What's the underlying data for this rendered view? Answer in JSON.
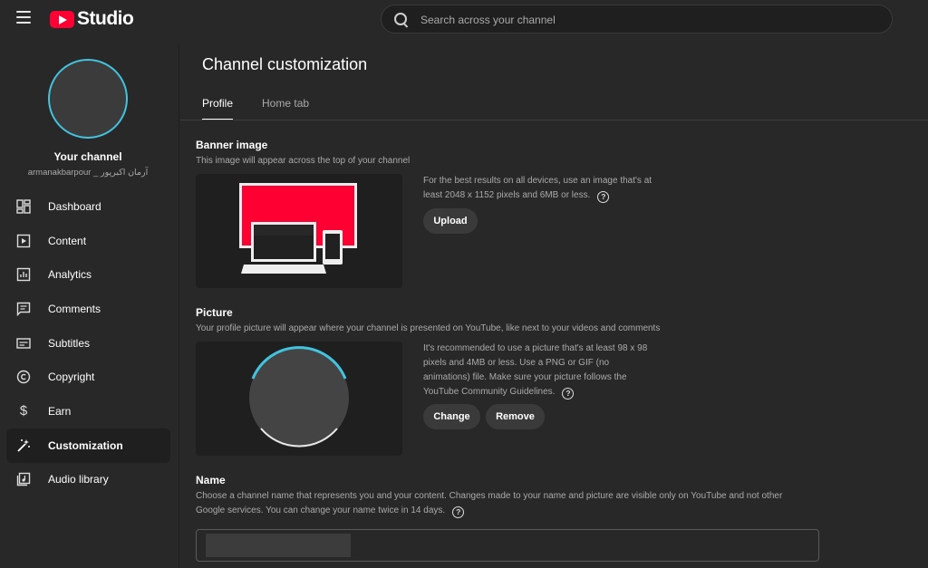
{
  "app": {
    "logo_text": "Studio",
    "brand_color": "#ff0033",
    "accent_color": "#42c3de"
  },
  "search": {
    "placeholder": "Search across your channel"
  },
  "sidebar": {
    "channel_title": "Your channel",
    "channel_handle": "armanakbarpour _ آرمان اکبرپور",
    "items": [
      {
        "label": "Dashboard",
        "icon": "dashboard-icon"
      },
      {
        "label": "Content",
        "icon": "content-icon"
      },
      {
        "label": "Analytics",
        "icon": "analytics-icon"
      },
      {
        "label": "Comments",
        "icon": "comments-icon"
      },
      {
        "label": "Subtitles",
        "icon": "subtitles-icon"
      },
      {
        "label": "Copyright",
        "icon": "copyright-icon"
      },
      {
        "label": "Earn",
        "icon": "earn-icon"
      },
      {
        "label": "Customization",
        "icon": "customization-icon",
        "active": true
      },
      {
        "label": "Audio library",
        "icon": "audio-library-icon"
      }
    ]
  },
  "main": {
    "title": "Channel customization",
    "tabs": [
      {
        "label": "Profile",
        "active": true
      },
      {
        "label": "Home tab"
      }
    ],
    "banner": {
      "title": "Banner image",
      "description": "This image will appear across the top of your channel",
      "info": "For the best results on all devices, use an image that's at least 2048 x 1152 pixels and 6MB or less.",
      "upload_label": "Upload"
    },
    "picture": {
      "title": "Picture",
      "description": "Your profile picture will appear where your channel is presented on YouTube, like next to your videos and comments",
      "info": "It's recommended to use a picture that's at least 98 x 98 pixels and 4MB or less. Use a PNG or GIF (no animations) file. Make sure your picture follows the YouTube Community Guidelines.",
      "change_label": "Change",
      "remove_label": "Remove"
    },
    "name": {
      "title": "Name",
      "description": "Choose a channel name that represents you and your content. Changes made to your name and picture are visible only on YouTube and not other Google services. You can change your name twice in 14 days."
    }
  }
}
